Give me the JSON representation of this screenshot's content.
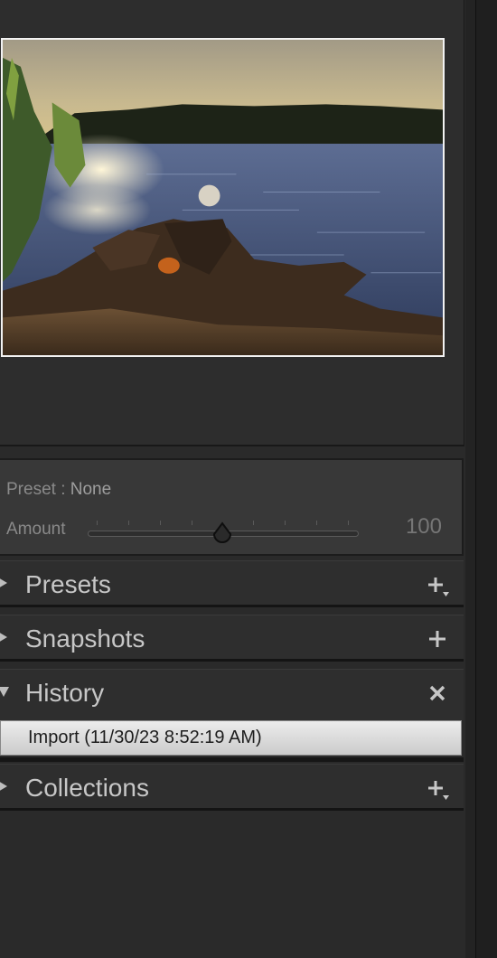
{
  "preset": {
    "label": "Preset : ",
    "value": "None"
  },
  "amount": {
    "label": "Amount",
    "value": "100",
    "fraction": 0.5
  },
  "sections": {
    "presets": {
      "title": "Presets",
      "action_icon": "plus-dropdown-icon"
    },
    "snapshots": {
      "title": "Snapshots",
      "action_icon": "plus-icon"
    },
    "history": {
      "title": "History",
      "action_icon": "close-icon",
      "items": [
        {
          "label": "Import (11/30/23 8:52:19 AM)"
        }
      ]
    },
    "collections": {
      "title": "Collections",
      "action_icon": "plus-dropdown-icon"
    }
  },
  "colors": {
    "panel": "#2e2e2e",
    "selected_item": "#dcdcdc",
    "text": "#c7c7c7",
    "muted_text": "#8a8a8a"
  }
}
